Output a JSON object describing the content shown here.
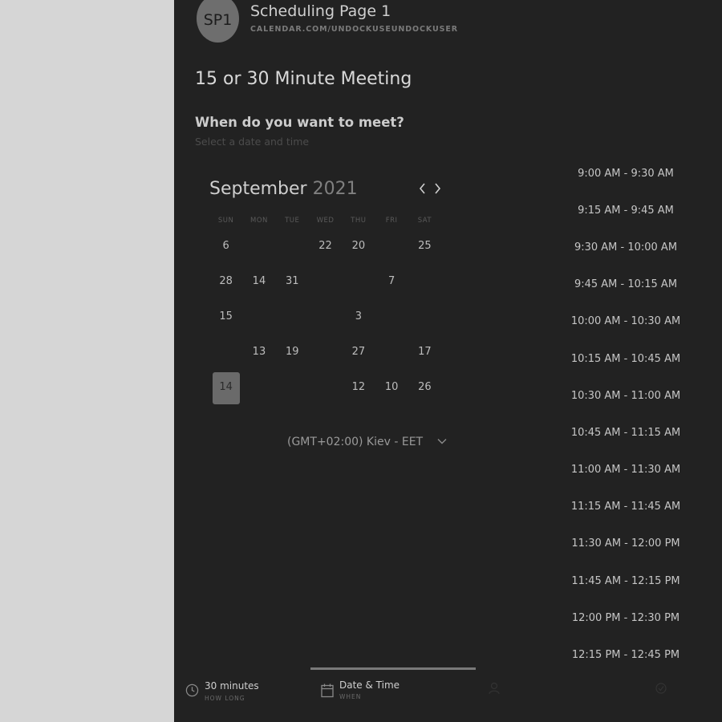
{
  "header": {
    "avatar_initials": "SP1",
    "page_name": "Scheduling Page 1",
    "page_url": "CALENDAR.COM/UNDOCKUSEUNDOCKUSER"
  },
  "event": {
    "title": "15 or 30 Minute Meeting",
    "question": "When do you want to meet?",
    "question_sub": "Select a date and time"
  },
  "calendar": {
    "month": "September",
    "year": "2021",
    "prev_icon": "chevron-left-icon",
    "next_icon": "chevron-right-icon",
    "weekdays": [
      "SUN",
      "MON",
      "TUE",
      "WED",
      "THU",
      "FRI",
      "SAT"
    ],
    "rows": [
      [
        {
          "d": "6",
          "s": "on"
        },
        {
          "d": "",
          "s": "off"
        },
        {
          "d": "",
          "s": "off"
        },
        {
          "d": "22",
          "s": "on"
        },
        {
          "d": "20",
          "s": "on"
        },
        {
          "d": "",
          "s": "off"
        },
        {
          "d": "25",
          "s": "on"
        }
      ],
      [
        {
          "d": "28",
          "s": "on"
        },
        {
          "d": "14",
          "s": "on"
        },
        {
          "d": "31",
          "s": "on"
        },
        {
          "d": "",
          "s": "off"
        },
        {
          "d": "",
          "s": "off"
        },
        {
          "d": "7",
          "s": "on"
        },
        {
          "d": "",
          "s": "off"
        }
      ],
      [
        {
          "d": "15",
          "s": "on"
        },
        {
          "d": "",
          "s": "off"
        },
        {
          "d": "",
          "s": "off"
        },
        {
          "d": "",
          "s": "off"
        },
        {
          "d": "3",
          "s": "on"
        },
        {
          "d": "",
          "s": "off"
        },
        {
          "d": "",
          "s": "off"
        }
      ],
      [
        {
          "d": "",
          "s": "off"
        },
        {
          "d": "13",
          "s": "on"
        },
        {
          "d": "19",
          "s": "on"
        },
        {
          "d": "",
          "s": "off"
        },
        {
          "d": "27",
          "s": "on"
        },
        {
          "d": "",
          "s": "off"
        },
        {
          "d": "17",
          "s": "on"
        }
      ],
      [
        {
          "d": "14",
          "s": "selected"
        },
        {
          "d": "",
          "s": "off"
        },
        {
          "d": "",
          "s": "off"
        },
        {
          "d": "",
          "s": "off"
        },
        {
          "d": "12",
          "s": "on"
        },
        {
          "d": "10",
          "s": "on"
        },
        {
          "d": "26",
          "s": "on"
        }
      ]
    ]
  },
  "timezone": {
    "label": "(GMT+02:00) Kiev - EET",
    "icon": "chevron-down-icon"
  },
  "time_slots": [
    "9:00 AM - 9:30 AM",
    "9:15 AM - 9:45 AM",
    "9:30 AM - 10:00 AM",
    "9:45 AM - 10:15 AM",
    "10:00 AM - 10:30 AM",
    "10:15 AM - 10:45 AM",
    "10:30 AM - 11:00 AM",
    "10:45 AM - 11:15 AM",
    "11:00 AM - 11:30 AM",
    "11:15 AM - 11:45 AM",
    "11:30 AM - 12:00 PM",
    "11:45 AM - 12:15 PM",
    "12:00 PM - 12:30 PM",
    "12:15 PM - 12:45 PM"
  ],
  "steps": [
    {
      "label": "30 minutes",
      "sub": "HOW LONG",
      "icon": "clock-icon"
    },
    {
      "label": "Date & Time",
      "sub": "WHEN",
      "icon": "calendar-icon"
    },
    {
      "label": "",
      "sub": "",
      "icon": "user-icon"
    },
    {
      "label": "",
      "sub": "",
      "icon": "check-icon"
    }
  ],
  "colors": {
    "panel_bg": "#222222",
    "page_bg": "#d6d6d6",
    "selected_day": "#6a6a6a"
  }
}
